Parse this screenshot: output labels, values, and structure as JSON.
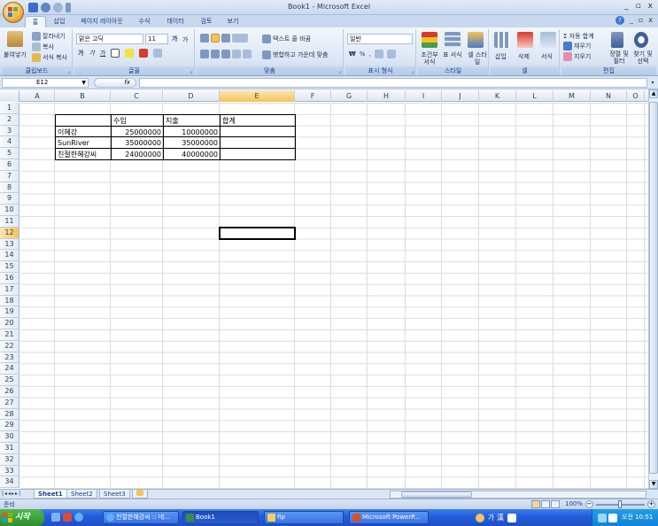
{
  "window": {
    "title": "Book1 - Microsoft Excel",
    "controls": [
      "_",
      "▫",
      "x"
    ]
  },
  "ribbon": {
    "tabs": [
      "홈",
      "삽입",
      "페이지 레이아웃",
      "수식",
      "데이터",
      "검토",
      "보기"
    ],
    "clipboard": {
      "paste": "붙여넣기",
      "cut": "잘라내기",
      "copy": "복사",
      "format_painter": "서식 복사",
      "label": "클립보드"
    },
    "font": {
      "name": "맑은 고딕",
      "size": "11",
      "label": "글꼴",
      "grow": "가",
      "shrink": "가"
    },
    "alignment": {
      "wrap": "텍스트 줄 바꿈",
      "merge": "병합하고 가운데 맞춤",
      "label": "맞춤"
    },
    "number": {
      "format": "일반",
      "label": "표시 형식"
    },
    "styles": {
      "conditional": "조건부 서식",
      "table": "표 서식",
      "cell": "셀 스타일",
      "label": "스타일"
    },
    "cells": {
      "insert": "삽입",
      "delete": "삭제",
      "format": "서식",
      "label": "셀"
    },
    "editing": {
      "autosum": "Σ 자동 합계",
      "fill": "채우기",
      "clear": "지우기",
      "sort": "정렬 및 필터",
      "find": "찾기 및 선택",
      "label": "편집"
    }
  },
  "formula_bar": {
    "name_box": "E12",
    "fx": "fx",
    "value": ""
  },
  "sheet": {
    "columns": [
      "A",
      "B",
      "C",
      "D",
      "E",
      "F",
      "G",
      "H",
      "I",
      "J",
      "K",
      "L",
      "M",
      "N",
      "O"
    ],
    "rows": [
      "1",
      "2",
      "3",
      "4",
      "5",
      "6",
      "7",
      "8",
      "9",
      "10",
      "11",
      "12",
      "13",
      "14",
      "15",
      "16",
      "17",
      "18",
      "19",
      "20",
      "21",
      "22",
      "23",
      "24",
      "25",
      "26",
      "27",
      "28",
      "29",
      "30",
      "31",
      "32",
      "33",
      "34"
    ],
    "active_cell": "E12",
    "table": {
      "headers": [
        "",
        "수입",
        "지출",
        "합계"
      ],
      "rows": [
        [
          "이혜강",
          "25000000",
          "10000000",
          ""
        ],
        [
          "SunRiver",
          "35000000",
          "35000000",
          ""
        ],
        [
          "친절한혜강씨",
          "24000000",
          "40000000",
          ""
        ]
      ]
    }
  },
  "sheet_tabs": [
    "Sheet1",
    "Sheet2",
    "Sheet3"
  ],
  "status": {
    "mode": "준비",
    "zoom": "100%"
  },
  "taskbar": {
    "start": "시작",
    "tasks": [
      "친절한혜강씨 :: 네...",
      "Book1",
      "fip",
      "Microsoft PowerP..."
    ],
    "ime": "가 漢",
    "clock": "오전 10:51"
  }
}
